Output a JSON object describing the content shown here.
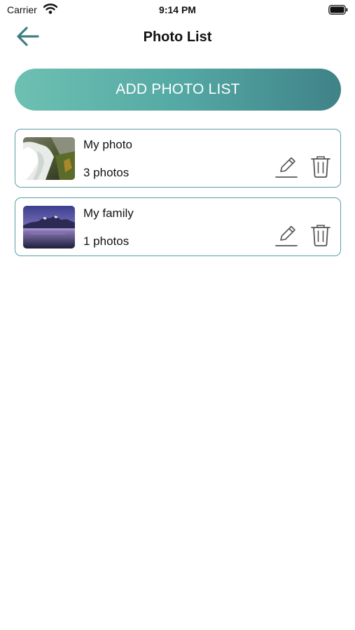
{
  "status_bar": {
    "carrier": "Carrier",
    "time": "9:14 PM",
    "icons": [
      "wifi-icon",
      "battery-icon"
    ]
  },
  "nav": {
    "title": "Photo List",
    "back_icon": "arrow-left-icon"
  },
  "add_button": {
    "label": "ADD PHOTO LIST"
  },
  "albums": [
    {
      "name": "My photo",
      "count": "3 photos",
      "thumbnail": "waterfall-photo"
    },
    {
      "name": "My family",
      "count": "1 photos",
      "thumbnail": "mountain-lake-photo"
    }
  ],
  "colors": {
    "accent": "#3f8288",
    "gradient_start": "#6dc0b2",
    "gradient_end": "#3f8288",
    "card_border": "#5a9ea2"
  }
}
